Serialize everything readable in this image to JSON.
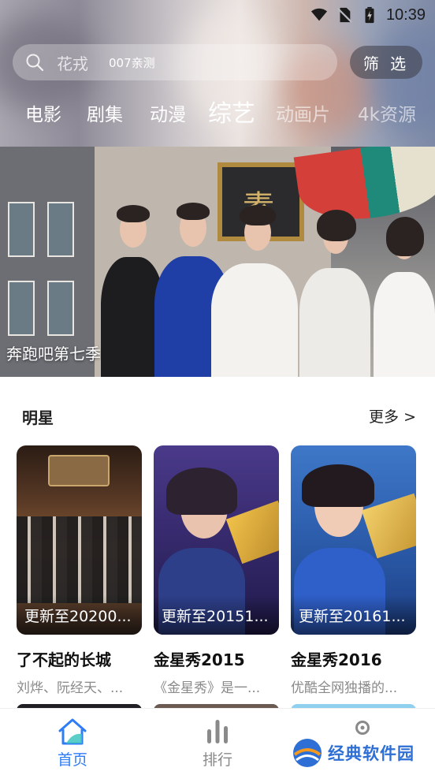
{
  "status_bar": {
    "time": "10:39",
    "icons": [
      "wifi-icon",
      "no-sim-icon",
      "battery-charging-icon"
    ]
  },
  "search": {
    "icon": "search-icon",
    "placeholder": "花戎",
    "tag": "007亲测"
  },
  "filter_button": {
    "label": "筛 选"
  },
  "categories": [
    {
      "label": "电影",
      "active": false
    },
    {
      "label": "剧集",
      "active": false
    },
    {
      "label": "动漫",
      "active": false
    },
    {
      "label": "综艺",
      "active": true
    },
    {
      "label": "动画片",
      "active": false
    },
    {
      "label": "4k资源",
      "active": false
    }
  ],
  "banner": {
    "title": "奔跑吧第七季"
  },
  "section": {
    "title": "明星",
    "more": "更多 >",
    "cards": [
      {
        "badge": "更新至20200...",
        "name": "了不起的长城",
        "desc": "刘烨、阮经天、..."
      },
      {
        "badge": "更新至20151...",
        "name": "金星秀2015",
        "desc": "《金星秀》是一..."
      },
      {
        "badge": "更新至20161...",
        "name": "金星秀2016",
        "desc": "优酷全网独播的..."
      }
    ]
  },
  "bottom_nav": {
    "items": [
      {
        "label": "首页",
        "icon": "home-icon",
        "active": true
      },
      {
        "label": "排行",
        "icon": "ranking-icon",
        "active": false
      },
      {
        "label": "",
        "icon": "profile-icon",
        "active": false
      }
    ]
  },
  "watermark": {
    "text": "经典软件园",
    "icon": "watermark-logo-icon"
  },
  "colors": {
    "accent": "#2e7cf6",
    "nav_inactive": "#888888",
    "watermark": "#2e6fd6"
  }
}
